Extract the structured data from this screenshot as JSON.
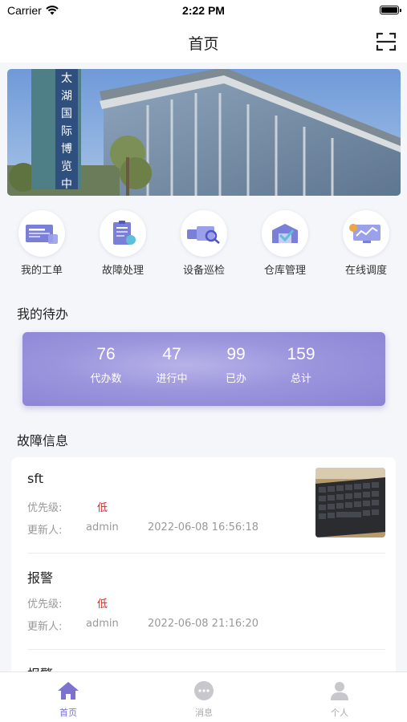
{
  "status_bar": {
    "carrier": "Carrier",
    "time": "2:22 PM"
  },
  "nav": {
    "title": "首页",
    "scan_icon": "scan-icon"
  },
  "banner": {
    "sign_text": "太湖国际博览中心"
  },
  "quick_actions": [
    {
      "label": "我的工单",
      "icon": "work-order-icon"
    },
    {
      "label": "故障处理",
      "icon": "fault-handling-icon"
    },
    {
      "label": "设备巡检",
      "icon": "device-inspection-icon"
    },
    {
      "label": "仓库管理",
      "icon": "warehouse-icon"
    },
    {
      "label": "在线调度",
      "icon": "online-dispatch-icon"
    }
  ],
  "todo": {
    "title": "我的待办",
    "stats": [
      {
        "value": "76",
        "label": "代办数"
      },
      {
        "value": "47",
        "label": "进行中"
      },
      {
        "value": "99",
        "label": "已办"
      },
      {
        "value": "159",
        "label": "总计"
      }
    ]
  },
  "faults": {
    "title": "故障信息",
    "priority_label": "优先级:",
    "updater_label": "更新人:",
    "items": [
      {
        "title": "sft",
        "priority": "低",
        "updater": "admin",
        "updated_at": "2022-06-08 16:56:18"
      },
      {
        "title": "报警",
        "priority": "低",
        "updater": "admin",
        "updated_at": "2022-06-08 21:16:20"
      },
      {
        "title": "报警"
      }
    ]
  },
  "tabs": [
    {
      "label": "首页",
      "icon": "home-icon",
      "active": true
    },
    {
      "label": "消息",
      "icon": "message-icon",
      "active": false
    },
    {
      "label": "个人",
      "icon": "profile-icon",
      "active": false
    }
  ],
  "colors": {
    "accent": "#7b73cf",
    "priority_low": "#dd2222",
    "card_gradient": "#9b95dd"
  }
}
